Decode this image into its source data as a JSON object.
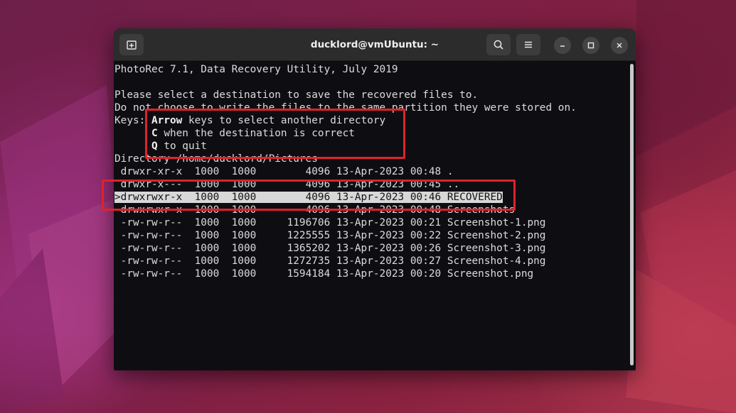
{
  "window": {
    "title": "ducklord@vmUbuntu: ~"
  },
  "icons": [
    "new-tab-icon",
    "search-icon",
    "menu-icon",
    "minimize-icon",
    "maximize-icon",
    "close-icon"
  ],
  "terminal": {
    "header": "PhotoRec 7.1, Data Recovery Utility, July 2019",
    "prompt_line1": "Please select a destination to save the recovered files to.",
    "prompt_line2": "Do not choose to write the files to the same partition they were stored on.",
    "keys_prefix": "Keys: ",
    "key1_bold": "Arrow",
    "key1_rest": " keys to select another directory",
    "key2_bold": "C",
    "key2_rest": " when the destination is correct",
    "key3_bold": "Q",
    "key3_rest": " to quit",
    "directory_label": "Directory /home/ducklord/Pictures",
    "entries": [
      {
        "cursor": " ",
        "perms": "drwxr-xr-x",
        "uid": "1000",
        "gid": "1000",
        "size": "4096",
        "date": "13-Apr-2023",
        "time": "00:48",
        "name": "."
      },
      {
        "cursor": " ",
        "perms": "drwxr-x---",
        "uid": "1000",
        "gid": "1000",
        "size": "4096",
        "date": "13-Apr-2023",
        "time": "00:45",
        "name": ".."
      },
      {
        "cursor": ">",
        "perms": "drwxrwxr-x",
        "uid": "1000",
        "gid": "1000",
        "size": "4096",
        "date": "13-Apr-2023",
        "time": "00:46",
        "name": "RECOVERED",
        "selected": true
      },
      {
        "cursor": " ",
        "perms": "drwxrwxr-x",
        "uid": "1000",
        "gid": "1000",
        "size": "4096",
        "date": "13-Apr-2023",
        "time": "00:48",
        "name": "Screenshots"
      },
      {
        "cursor": " ",
        "perms": "-rw-rw-r--",
        "uid": "1000",
        "gid": "1000",
        "size": "1196706",
        "date": "13-Apr-2023",
        "time": "00:21",
        "name": "Screenshot-1.png"
      },
      {
        "cursor": " ",
        "perms": "-rw-rw-r--",
        "uid": "1000",
        "gid": "1000",
        "size": "1225555",
        "date": "13-Apr-2023",
        "time": "00:22",
        "name": "Screenshot-2.png"
      },
      {
        "cursor": " ",
        "perms": "-rw-rw-r--",
        "uid": "1000",
        "gid": "1000",
        "size": "1365202",
        "date": "13-Apr-2023",
        "time": "00:26",
        "name": "Screenshot-3.png"
      },
      {
        "cursor": " ",
        "perms": "-rw-rw-r--",
        "uid": "1000",
        "gid": "1000",
        "size": "1272735",
        "date": "13-Apr-2023",
        "time": "00:27",
        "name": "Screenshot-4.png"
      },
      {
        "cursor": " ",
        "perms": "-rw-rw-r--",
        "uid": "1000",
        "gid": "1000",
        "size": "1594184",
        "date": "13-Apr-2023",
        "time": "00:20",
        "name": "Screenshot.png"
      }
    ]
  },
  "colors": {
    "highlight_box": "#e0222a",
    "terminal_bg": "#0e0e12",
    "titlebar_bg": "#2c2c2c",
    "selection_bg": "#d8d8d8"
  }
}
